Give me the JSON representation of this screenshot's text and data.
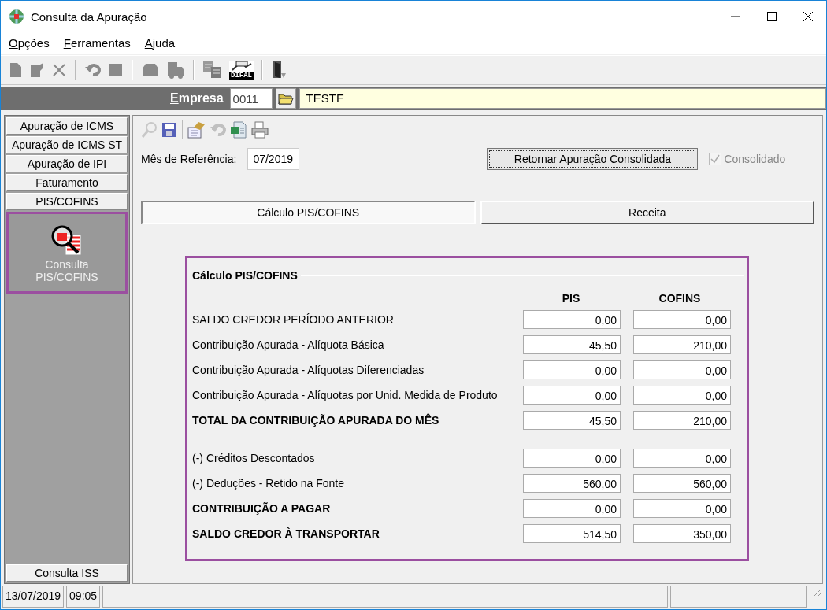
{
  "window": {
    "title": "Consulta da Apuração"
  },
  "menu": [
    "Opções",
    "Ferramentas",
    "Ajuda"
  ],
  "toolbar": [
    {
      "kind": "new"
    },
    {
      "kind": "edit"
    },
    {
      "kind": "delete"
    },
    {
      "kind": "sep"
    },
    {
      "kind": "undo"
    },
    {
      "kind": "stop"
    },
    {
      "kind": "sep"
    },
    {
      "kind": "print"
    },
    {
      "kind": "truck"
    },
    {
      "kind": "sep"
    },
    {
      "kind": "copy"
    },
    {
      "kind": "difal",
      "label": "DIFAL"
    },
    {
      "kind": "sep"
    },
    {
      "kind": "exit"
    }
  ],
  "empresa": {
    "label": "Empresa",
    "code": "0011",
    "name": "TESTE"
  },
  "sidebar": {
    "groups": [
      {
        "label": "Apuração de ICMS"
      },
      {
        "label": "Apuração de ICMS ST"
      },
      {
        "label": "Apuração de IPI"
      },
      {
        "label": "Faturamento"
      },
      {
        "label": "PIS/COFINS",
        "items": [
          {
            "label": "Consulta PIS/COFINS",
            "selected": true
          }
        ]
      },
      {
        "label": "Consulta ISS"
      }
    ]
  },
  "subtoolbar": [
    {
      "kind": "search"
    },
    {
      "kind": "save"
    },
    {
      "kind": "sep"
    },
    {
      "kind": "edit"
    },
    {
      "kind": "undo"
    },
    {
      "kind": "excel"
    },
    {
      "kind": "print"
    }
  ],
  "reference": {
    "label": "Mês de Referência:",
    "value": "07/2019"
  },
  "return_button": "Retornar Apuração Consolidada",
  "consolidado": {
    "label": "Consolidado",
    "checked": true,
    "disabled": true
  },
  "tabs": [
    {
      "label": "Cálculo PIS/COFINS",
      "selected": true
    },
    {
      "label": "Receita",
      "selected": false
    }
  ],
  "panel": {
    "title": "Cálculo PIS/COFINS",
    "columns": [
      "PIS",
      "COFINS"
    ],
    "rows": [
      {
        "label": "SALDO CREDOR PERÍODO ANTERIOR",
        "bold": false,
        "gap_before": false,
        "pis": "0,00",
        "cofins": "0,00"
      },
      {
        "label": "Contribuição Apurada - Alíquota Básica",
        "bold": false,
        "gap_before": false,
        "pis": "45,50",
        "cofins": "210,00"
      },
      {
        "label": "Contribuição Apurada - Alíquotas Diferenciadas",
        "bold": false,
        "gap_before": false,
        "pis": "0,00",
        "cofins": "0,00"
      },
      {
        "label": "Contribuição Apurada - Alíquotas por Unid. Medida de Produto",
        "bold": false,
        "gap_before": false,
        "pis": "0,00",
        "cofins": "0,00"
      },
      {
        "label": "TOTAL DA CONTRIBUIÇÃO APURADA DO MÊS",
        "bold": true,
        "gap_before": false,
        "pis": "45,50",
        "cofins": "210,00"
      },
      {
        "label": "(-) Créditos Descontados",
        "bold": false,
        "gap_before": true,
        "pis": "0,00",
        "cofins": "0,00"
      },
      {
        "label": "(-) Deduções - Retido na Fonte",
        "bold": false,
        "gap_before": false,
        "pis": "560,00",
        "cofins": "560,00"
      },
      {
        "label": "CONTRIBUIÇÃO A PAGAR",
        "bold": true,
        "gap_before": false,
        "pis": "0,00",
        "cofins": "0,00"
      },
      {
        "label": "SALDO CREDOR À TRANSPORTAR",
        "bold": true,
        "gap_before": false,
        "pis": "514,50",
        "cofins": "350,00"
      }
    ]
  },
  "status_bar": [
    "13/07/2019",
    "09:05"
  ]
}
